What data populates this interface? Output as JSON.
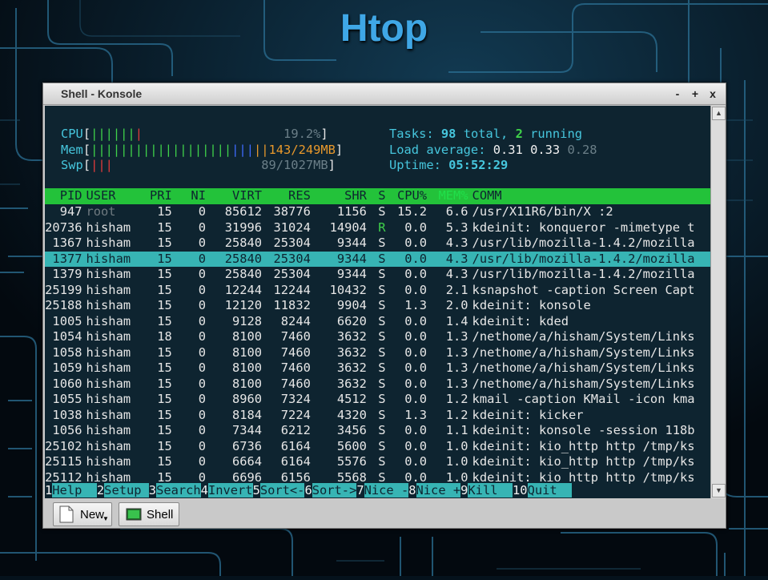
{
  "slide": {
    "title": "Htop"
  },
  "window": {
    "title": "Shell - Konsole",
    "minimize": "-",
    "maximize": "+",
    "close": "x"
  },
  "meters": {
    "cpu": {
      "label": "CPU",
      "open": "[",
      "bars": "||||||",
      "value": "19.2%",
      "close": "]"
    },
    "mem": {
      "label": "Mem",
      "open": "[",
      "bars_green": "|||||||||||||||||||",
      "bars_blue": "|||",
      "bars_orange": "||",
      "value": "143/249MB",
      "close": "]"
    },
    "swp": {
      "label": "Swp",
      "open": "[",
      "bars": "|||",
      "value": "89/1027MB",
      "close": "]"
    },
    "tasks": {
      "label": "Tasks: ",
      "total": "98",
      "total_label": " total, ",
      "running": "2",
      "running_label": " running"
    },
    "load": {
      "label": "Load average: ",
      "l1": "0.31",
      "l5": "0.33",
      "l15": "0.28"
    },
    "uptime": {
      "label": "Uptime: ",
      "value": "05:52:29"
    }
  },
  "columns": [
    "  PID",
    "USER",
    "PRI",
    "NI",
    "VIRT",
    "RES",
    "SHR",
    "S",
    "CPU%",
    "MEM%",
    "COMM"
  ],
  "processes": [
    {
      "pid": "947",
      "user": "root",
      "pri": "15",
      "ni": "0",
      "virt": "85612",
      "res": "38776",
      "shr": "1156",
      "s": "S",
      "cpu": "15.2",
      "mem": "6.6",
      "comm": "/usr/X11R6/bin/X :2"
    },
    {
      "pid": "20736",
      "user": "hisham",
      "pri": "15",
      "ni": "0",
      "virt": "31996",
      "res": "31024",
      "shr": "14904",
      "s": "R",
      "cpu": "0.0",
      "mem": "5.3",
      "comm": "kdeinit: konqueror -mimetype t"
    },
    {
      "pid": "1367",
      "user": "hisham",
      "pri": "15",
      "ni": "0",
      "virt": "25840",
      "res": "25304",
      "shr": "9344",
      "s": "S",
      "cpu": "0.0",
      "mem": "4.3",
      "comm": "/usr/lib/mozilla-1.4.2/mozilla"
    },
    {
      "pid": "1377",
      "user": "hisham",
      "pri": "15",
      "ni": "0",
      "virt": "25840",
      "res": "25304",
      "shr": "9344",
      "s": "S",
      "cpu": "0.0",
      "mem": "4.3",
      "comm": "/usr/lib/mozilla-1.4.2/mozilla"
    },
    {
      "pid": "1379",
      "user": "hisham",
      "pri": "15",
      "ni": "0",
      "virt": "25840",
      "res": "25304",
      "shr": "9344",
      "s": "S",
      "cpu": "0.0",
      "mem": "4.3",
      "comm": "/usr/lib/mozilla-1.4.2/mozilla"
    },
    {
      "pid": "25199",
      "user": "hisham",
      "pri": "15",
      "ni": "0",
      "virt": "12244",
      "res": "12244",
      "shr": "10432",
      "s": "S",
      "cpu": "0.0",
      "mem": "2.1",
      "comm": "ksnapshot -caption Screen Capt"
    },
    {
      "pid": "25188",
      "user": "hisham",
      "pri": "15",
      "ni": "0",
      "virt": "12120",
      "res": "11832",
      "shr": "9904",
      "s": "S",
      "cpu": "1.3",
      "mem": "2.0",
      "comm": "kdeinit: konsole"
    },
    {
      "pid": "1005",
      "user": "hisham",
      "pri": "15",
      "ni": "0",
      "virt": "9128",
      "res": "8244",
      "shr": "6620",
      "s": "S",
      "cpu": "0.0",
      "mem": "1.4",
      "comm": "kdeinit: kded"
    },
    {
      "pid": "1054",
      "user": "hisham",
      "pri": "18",
      "ni": "0",
      "virt": "8100",
      "res": "7460",
      "shr": "3632",
      "s": "S",
      "cpu": "0.0",
      "mem": "1.3",
      "comm": "/nethome/a/hisham/System/Links"
    },
    {
      "pid": "1058",
      "user": "hisham",
      "pri": "15",
      "ni": "0",
      "virt": "8100",
      "res": "7460",
      "shr": "3632",
      "s": "S",
      "cpu": "0.0",
      "mem": "1.3",
      "comm": "/nethome/a/hisham/System/Links"
    },
    {
      "pid": "1059",
      "user": "hisham",
      "pri": "15",
      "ni": "0",
      "virt": "8100",
      "res": "7460",
      "shr": "3632",
      "s": "S",
      "cpu": "0.0",
      "mem": "1.3",
      "comm": "/nethome/a/hisham/System/Links"
    },
    {
      "pid": "1060",
      "user": "hisham",
      "pri": "15",
      "ni": "0",
      "virt": "8100",
      "res": "7460",
      "shr": "3632",
      "s": "S",
      "cpu": "0.0",
      "mem": "1.3",
      "comm": "/nethome/a/hisham/System/Links"
    },
    {
      "pid": "1055",
      "user": "hisham",
      "pri": "15",
      "ni": "0",
      "virt": "8960",
      "res": "7324",
      "shr": "4512",
      "s": "S",
      "cpu": "0.0",
      "mem": "1.2",
      "comm": "kmail -caption KMail -icon kma"
    },
    {
      "pid": "1038",
      "user": "hisham",
      "pri": "15",
      "ni": "0",
      "virt": "8184",
      "res": "7224",
      "shr": "4320",
      "s": "S",
      "cpu": "1.3",
      "mem": "1.2",
      "comm": "kdeinit: kicker"
    },
    {
      "pid": "1056",
      "user": "hisham",
      "pri": "15",
      "ni": "0",
      "virt": "7344",
      "res": "6212",
      "shr": "3456",
      "s": "S",
      "cpu": "0.0",
      "mem": "1.1",
      "comm": "kdeinit: konsole -session 118b"
    },
    {
      "pid": "25102",
      "user": "hisham",
      "pri": "15",
      "ni": "0",
      "virt": "6736",
      "res": "6164",
      "shr": "5600",
      "s": "S",
      "cpu": "0.0",
      "mem": "1.0",
      "comm": "kdeinit: kio_http http /tmp/ks"
    },
    {
      "pid": "25115",
      "user": "hisham",
      "pri": "15",
      "ni": "0",
      "virt": "6664",
      "res": "6164",
      "shr": "5576",
      "s": "S",
      "cpu": "0.0",
      "mem": "1.0",
      "comm": "kdeinit: kio_http http /tmp/ks"
    },
    {
      "pid": "25112",
      "user": "hisham",
      "pri": "15",
      "ni": "0",
      "virt": "6696",
      "res": "6156",
      "shr": "5568",
      "s": "S",
      "cpu": "0.0",
      "mem": "1.0",
      "comm": "kdeinit: kio_http http /tmp/ks"
    }
  ],
  "selected_pid": "1377",
  "function_keys": [
    {
      "num": "1",
      "label": "Help  "
    },
    {
      "num": "2",
      "label": "Setup "
    },
    {
      "num": "3",
      "label": "Search"
    },
    {
      "num": "4",
      "label": "Invert"
    },
    {
      "num": "5",
      "label": "Sort<-"
    },
    {
      "num": "6",
      "label": "Sort->"
    },
    {
      "num": "7",
      "label": "Nice -"
    },
    {
      "num": "8",
      "label": "Nice +"
    },
    {
      "num": "9",
      "label": "Kill  "
    },
    {
      "num": "10",
      "label": "Quit  "
    }
  ],
  "taskbar": {
    "new_label": "New",
    "shell_label": "Shell"
  },
  "colors": {
    "accent": "#3fa7e6",
    "terminal_bg": "#0e2430",
    "header_green": "#23c23a",
    "selection": "#37b4b4"
  }
}
